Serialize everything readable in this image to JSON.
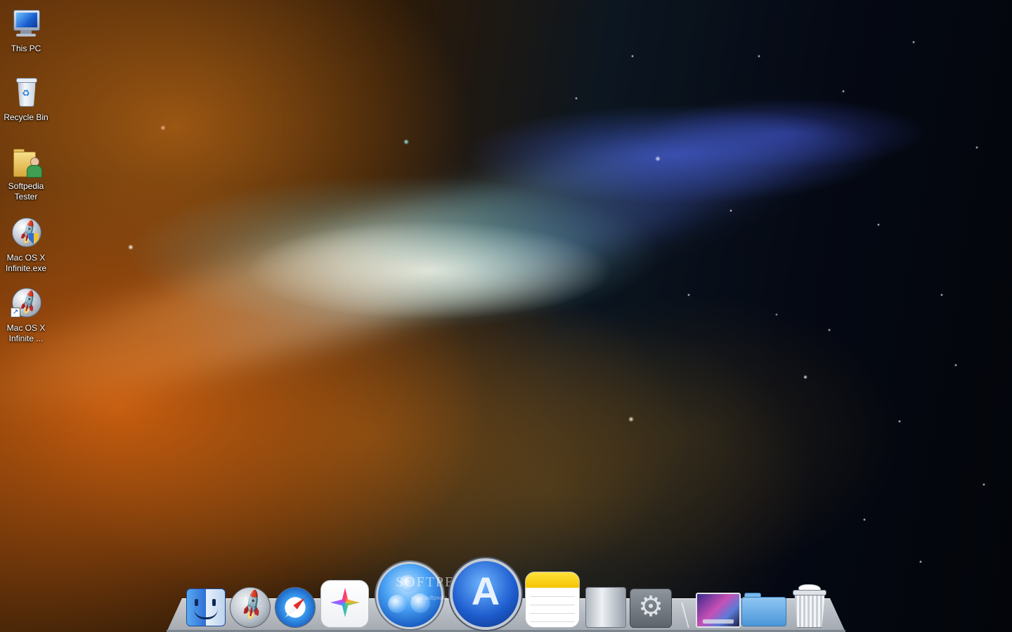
{
  "desktop": {
    "icons": [
      {
        "label": "This PC",
        "icon": "computer-icon"
      },
      {
        "label": "Recycle Bin",
        "icon": "recycle-bin-icon"
      },
      {
        "label": "Softpedia Tester",
        "icon": "user-folder-icon"
      },
      {
        "label": "Mac OS X Infinite.exe",
        "icon": "rocket-shield-icon"
      },
      {
        "label": "Mac OS X Infinite ...",
        "icon": "rocket-shortcut-icon"
      }
    ]
  },
  "dock": {
    "items": [
      {
        "name": "Finder",
        "icon": "finder-icon"
      },
      {
        "name": "Launchpad",
        "icon": "launchpad-icon"
      },
      {
        "name": "Safari",
        "icon": "safari-icon"
      },
      {
        "name": "Photos",
        "icon": "photos-icon"
      },
      {
        "name": "Game Center",
        "icon": "game-center-icon"
      },
      {
        "name": "App Store",
        "icon": "app-store-icon"
      },
      {
        "name": "Notes",
        "icon": "notes-icon"
      },
      {
        "name": "Mac Pro",
        "icon": "mac-pro-icon"
      },
      {
        "name": "System Preferences",
        "icon": "system-preferences-icon"
      },
      {
        "name": "Desktop",
        "icon": "desktop-stack-icon"
      },
      {
        "name": "Applications",
        "icon": "applications-folder-icon"
      },
      {
        "name": "Trash",
        "icon": "trash-icon"
      }
    ],
    "watermark": "SOFTPEDIA",
    "watermark_url": "www.softpedia.com"
  },
  "colors": {
    "nebula_orange": "#c85f0f",
    "nebula_blue": "#4f6eff",
    "space": "#05070f",
    "dock_shelf": "#c9ced4"
  }
}
